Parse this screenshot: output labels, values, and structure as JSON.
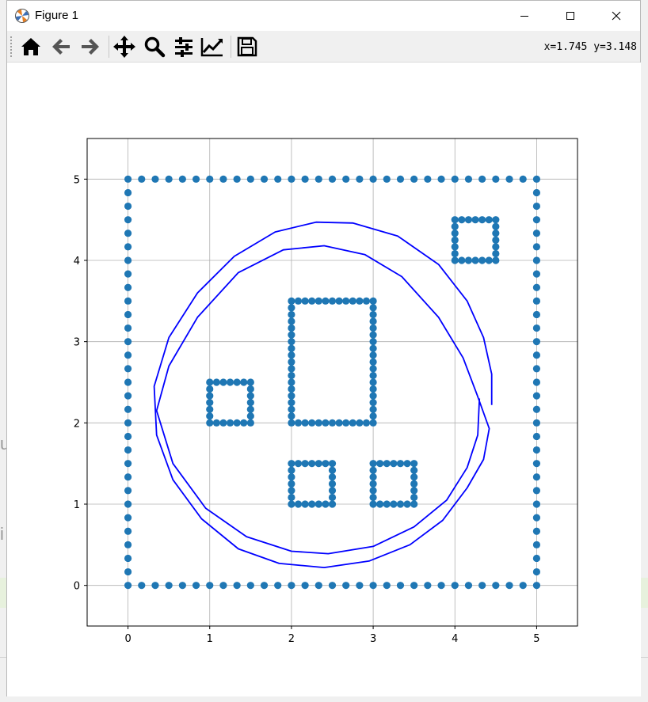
{
  "window": {
    "title": "Figure 1",
    "app_icon": "matplotlib-icon",
    "controls": [
      {
        "name": "minimize-button",
        "icon": "minimize-icon"
      },
      {
        "name": "maximize-button",
        "icon": "maximize-icon"
      },
      {
        "name": "close-button",
        "icon": "close-icon"
      }
    ]
  },
  "toolbar": {
    "buttons": [
      {
        "name": "home-button",
        "icon": "home-icon"
      },
      {
        "name": "back-button",
        "icon": "arrow-left-icon"
      },
      {
        "name": "forward-button",
        "icon": "arrow-right-icon"
      },
      {
        "name": "pan-button",
        "icon": "move-icon"
      },
      {
        "name": "zoom-button",
        "icon": "magnifier-icon"
      },
      {
        "name": "subplots-button",
        "icon": "sliders-icon"
      },
      {
        "name": "edit-axis-button",
        "icon": "line-chart-icon"
      },
      {
        "name": "save-button",
        "icon": "floppy-disk-icon"
      }
    ],
    "coords": "x=1.745 y=3.148"
  },
  "background": {
    "fragment_1": "u",
    "fragment_2": "i"
  },
  "colors": {
    "scatter": "#1f77b4",
    "curve": "#0000ff",
    "grid": "#b0b0b0"
  },
  "chart_data": {
    "type": "scatter",
    "title": "",
    "xlabel": "",
    "ylabel": "",
    "xlim": [
      -0.5,
      5.5
    ],
    "ylim": [
      -0.5,
      5.5
    ],
    "xticks": [
      0,
      1,
      2,
      3,
      4,
      5
    ],
    "yticks": [
      0,
      1,
      2,
      3,
      4,
      5
    ],
    "grid": true,
    "obstacles": [
      {
        "x0": 0,
        "x1": 5,
        "y0": 0,
        "y1": 5,
        "step": 0.166667
      },
      {
        "x0": 4,
        "x1": 4.5,
        "y0": 4,
        "y1": 4.5,
        "step": 0.083333
      },
      {
        "x0": 1,
        "x1": 1.5,
        "y0": 2,
        "y1": 2.5,
        "step": 0.083333
      },
      {
        "x0": 2,
        "x1": 3,
        "y0": 2,
        "y1": 3.5,
        "step": 0.083333
      },
      {
        "x0": 2,
        "x1": 2.5,
        "y0": 1,
        "y1": 1.5,
        "step": 0.083333
      },
      {
        "x0": 3,
        "x1": 3.5,
        "y0": 1,
        "y1": 1.5,
        "step": 0.083333
      }
    ],
    "path": [
      [
        4.45,
        2.22
      ],
      [
        4.45,
        2.6
      ],
      [
        4.35,
        3.05
      ],
      [
        4.15,
        3.5
      ],
      [
        3.8,
        3.95
      ],
      [
        3.3,
        4.3
      ],
      [
        2.75,
        4.46
      ],
      [
        2.3,
        4.47
      ],
      [
        1.8,
        4.35
      ],
      [
        1.3,
        4.05
      ],
      [
        0.85,
        3.6
      ],
      [
        0.5,
        3.05
      ],
      [
        0.32,
        2.45
      ],
      [
        0.35,
        1.85
      ],
      [
        0.55,
        1.3
      ],
      [
        0.9,
        0.82
      ],
      [
        1.35,
        0.45
      ],
      [
        1.85,
        0.27
      ],
      [
        2.4,
        0.22
      ],
      [
        2.95,
        0.3
      ],
      [
        3.45,
        0.5
      ],
      [
        3.85,
        0.8
      ],
      [
        4.15,
        1.2
      ],
      [
        4.35,
        1.55
      ],
      [
        4.42,
        1.93
      ],
      [
        4.27,
        2.35
      ],
      [
        4.1,
        2.8
      ],
      [
        3.8,
        3.3
      ],
      [
        3.35,
        3.8
      ],
      [
        2.9,
        4.07
      ],
      [
        2.4,
        4.18
      ],
      [
        1.9,
        4.13
      ],
      [
        1.35,
        3.85
      ],
      [
        0.85,
        3.3
      ],
      [
        0.5,
        2.7
      ],
      [
        0.35,
        2.15
      ],
      [
        0.55,
        1.5
      ],
      [
        0.95,
        0.95
      ],
      [
        1.45,
        0.6
      ],
      [
        2.0,
        0.42
      ],
      [
        2.45,
        0.39
      ],
      [
        3.0,
        0.48
      ],
      [
        3.5,
        0.72
      ],
      [
        3.9,
        1.05
      ],
      [
        4.15,
        1.45
      ],
      [
        4.28,
        1.85
      ],
      [
        4.3,
        2.3
      ]
    ]
  }
}
